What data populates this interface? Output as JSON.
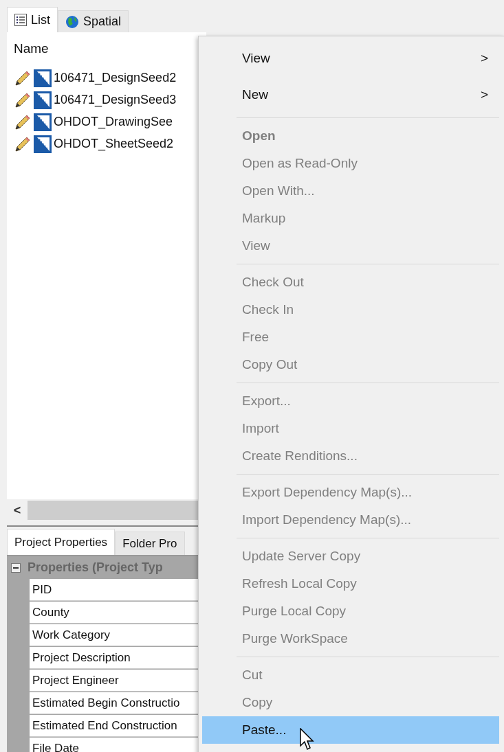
{
  "list_panel": {
    "tabs": [
      {
        "label": "List",
        "selected": true
      },
      {
        "label": "Spatial",
        "selected": false
      }
    ],
    "column_header": "Name",
    "files": [
      {
        "name": "106471_DesignSeed2"
      },
      {
        "name": "106471_DesignSeed3"
      },
      {
        "name": "OHDOT_DrawingSee"
      },
      {
        "name": "OHDOT_SheetSeed2"
      }
    ],
    "scroll_left": "<"
  },
  "properties_panel": {
    "tabs": [
      {
        "label": "Project Properties",
        "selected": true
      },
      {
        "label": "Folder Pro",
        "selected": false
      }
    ],
    "category": {
      "label": "Properties (Project Typ",
      "expanded": true
    },
    "rows": [
      "PID",
      "County",
      "Work Category",
      "Project Description",
      "Project Engineer",
      "Estimated Begin Constructio",
      "Estimated End Construction",
      "File Date"
    ]
  },
  "context_menu": {
    "groups": [
      {
        "items": [
          {
            "label": "View",
            "arrow": ">",
            "disabled": false,
            "default": false,
            "selected": false
          },
          {
            "label": "New",
            "arrow": ">",
            "disabled": false,
            "default": false,
            "selected": false
          }
        ]
      },
      {
        "items": [
          {
            "label": "Open",
            "disabled": true,
            "default": true,
            "selected": false
          },
          {
            "label": "Open as Read-Only",
            "disabled": true,
            "default": false,
            "selected": false
          },
          {
            "label": "Open With...",
            "disabled": true,
            "default": false,
            "selected": false
          },
          {
            "label": "Markup",
            "disabled": true,
            "default": false,
            "selected": false
          },
          {
            "label": "View",
            "disabled": true,
            "default": false,
            "selected": false
          }
        ]
      },
      {
        "items": [
          {
            "label": "Check Out",
            "disabled": true,
            "default": false,
            "selected": false
          },
          {
            "label": "Check In",
            "disabled": true,
            "default": false,
            "selected": false
          },
          {
            "label": "Free",
            "disabled": true,
            "default": false,
            "selected": false
          },
          {
            "label": "Copy Out",
            "disabled": true,
            "default": false,
            "selected": false
          }
        ]
      },
      {
        "items": [
          {
            "label": "Export...",
            "disabled": true,
            "default": false,
            "selected": false
          },
          {
            "label": "Import",
            "disabled": true,
            "default": false,
            "selected": false
          },
          {
            "label": "Create Renditions...",
            "disabled": true,
            "default": false,
            "selected": false
          }
        ]
      },
      {
        "items": [
          {
            "label": "Export Dependency Map(s)...",
            "disabled": true,
            "default": false,
            "selected": false
          },
          {
            "label": "Import Dependency Map(s)...",
            "disabled": true,
            "default": false,
            "selected": false
          }
        ]
      },
      {
        "items": [
          {
            "label": "Update Server Copy",
            "disabled": true,
            "default": false,
            "selected": false
          },
          {
            "label": "Refresh Local Copy",
            "disabled": true,
            "default": false,
            "selected": false
          },
          {
            "label": "Purge Local Copy",
            "disabled": true,
            "default": false,
            "selected": false
          },
          {
            "label": "Purge WorkSpace",
            "disabled": true,
            "default": false,
            "selected": false
          }
        ]
      },
      {
        "items": [
          {
            "label": "Cut",
            "disabled": true,
            "default": false,
            "selected": false
          },
          {
            "label": "Copy",
            "disabled": true,
            "default": false,
            "selected": false
          },
          {
            "label": "Paste...",
            "disabled": false,
            "default": false,
            "selected": true
          }
        ]
      }
    ]
  }
}
